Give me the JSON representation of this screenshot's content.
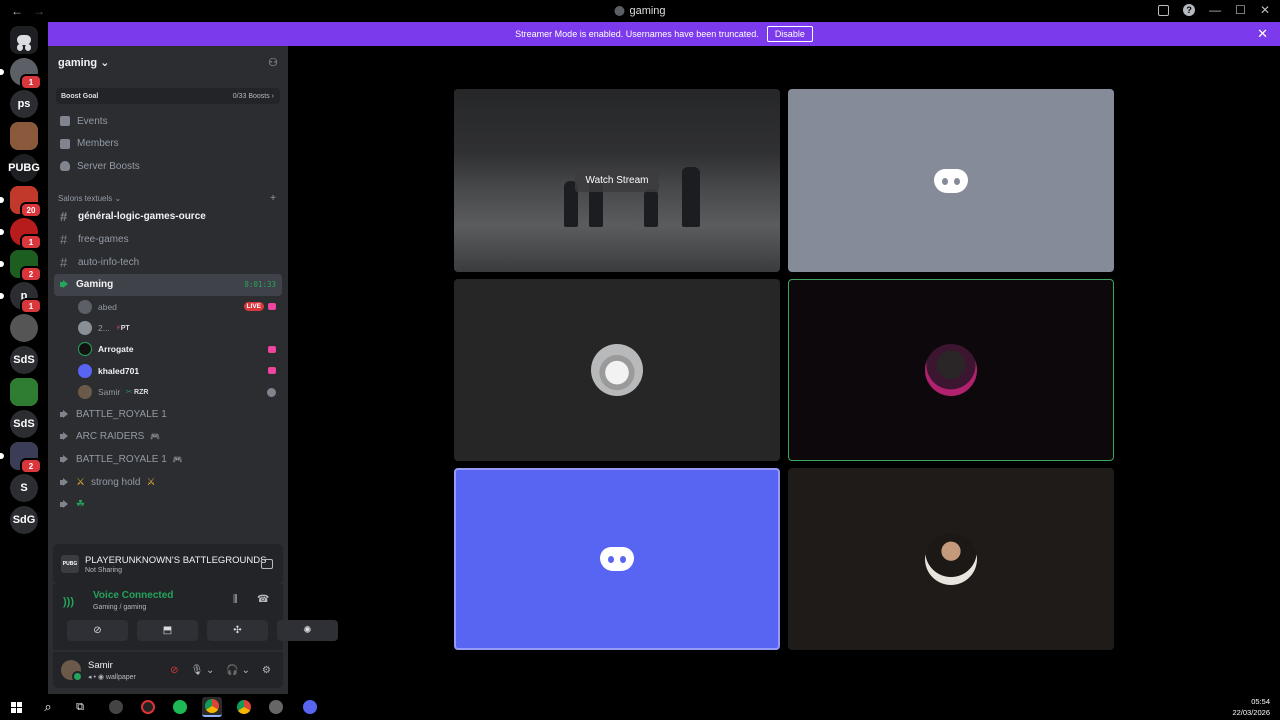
{
  "titlebar": {
    "title": "gaming",
    "back": "←",
    "forward": "→",
    "minimize": "—",
    "maximize": "☐",
    "close": "✕"
  },
  "banner": {
    "text": "Streamer Mode is enabled. Usernames have been truncated.",
    "button": "Disable",
    "close": "✕"
  },
  "rail": {
    "servers": [
      {
        "label": "",
        "badge": "1"
      },
      {
        "label": "ps",
        "badge": ""
      },
      {
        "label": "",
        "badge": ""
      },
      {
        "label": "PUBG",
        "badge": ""
      },
      {
        "label": "",
        "badge": "20"
      },
      {
        "label": "",
        "badge": "1"
      },
      {
        "label": "",
        "badge": "2"
      },
      {
        "label": "p",
        "badge": "1"
      },
      {
        "label": "",
        "badge": ""
      },
      {
        "label": "SdS",
        "badge": ""
      },
      {
        "label": "",
        "badge": ""
      },
      {
        "label": "SdS",
        "badge": ""
      },
      {
        "label": "",
        "badge": "2"
      },
      {
        "label": "S",
        "badge": ""
      },
      {
        "label": "SdG",
        "badge": ""
      }
    ]
  },
  "sidebar": {
    "server_name": "gaming",
    "boost": {
      "label": "Boost Goal",
      "value": "0/33 Boosts"
    },
    "nav": [
      {
        "label": "Events"
      },
      {
        "label": "Members"
      },
      {
        "label": "Server Boosts"
      }
    ],
    "category": "Salons textuels",
    "text_channels": [
      {
        "name": "général-logic-games-ource"
      },
      {
        "name": "free-games"
      },
      {
        "name": "auto-info-tech"
      }
    ],
    "voice_active": {
      "name": "Gaming",
      "timer": "8:01:33"
    },
    "voice_users": [
      {
        "name": "abed",
        "extra": "LIVE"
      },
      {
        "name": "2...",
        "extra": "PT"
      },
      {
        "name": "Arrogate",
        "extra": ""
      },
      {
        "name": "khaled701",
        "extra": ""
      },
      {
        "name": "Samir",
        "extra": "RZR"
      }
    ],
    "voice_channels": [
      {
        "name": "BATTLE_ROYALE 1"
      },
      {
        "name": "ARC RAIDERS"
      },
      {
        "name": "BATTLE_ROYALE 1"
      },
      {
        "name": "strong hold"
      },
      {
        "name": "☘"
      }
    ]
  },
  "activity": {
    "game": "PLAYERUNKNOWN'S BATTLEGROUNDS",
    "status": "Not Sharing",
    "icon": "PUBG"
  },
  "voice": {
    "status": "Voice Connected",
    "location": "Gaming / gaming"
  },
  "user": {
    "name": "Samir",
    "status": "wallpaper"
  },
  "stage": {
    "watch_label": "Watch Stream"
  },
  "taskbar": {
    "time": "05:54",
    "date": "22/03/2026"
  }
}
